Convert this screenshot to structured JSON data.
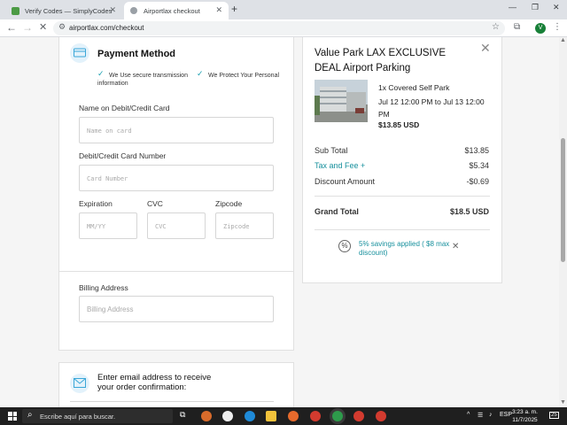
{
  "browser": {
    "tabs": [
      {
        "title": "Verify Codes — SimplyCodes",
        "active": false
      },
      {
        "title": "Airportlax checkout",
        "active": true
      }
    ],
    "url": "airportlax.com/checkout",
    "profile_initial": "V"
  },
  "payment": {
    "title": "Payment Method",
    "secure_note": "We Use secure transmission",
    "protect_note": "We Protect Your Personal information",
    "name_label": "Name on Debit/Credit Card",
    "name_placeholder": "Name on card",
    "number_label": "Debit/Credit Card Number",
    "number_placeholder": "Card Number",
    "expiration_label": "Expiration",
    "expiration_placeholder": "MM/YY",
    "cvc_label": "CVC",
    "cvc_placeholder": "CVC",
    "zip_label": "Zipcode",
    "zip_placeholder": "Zipcode"
  },
  "billing": {
    "label": "Billing Address",
    "placeholder": "Billing Address"
  },
  "email": {
    "title": "Enter email address to receive your order confirmation:"
  },
  "summary": {
    "title": "Value Park LAX EXCLUSIVE DEAL Airport Parking",
    "item": "1x Covered Self Park",
    "dates": "Jul 12 12:00 PM to Jul 13 12:00 PM",
    "item_price": "$13.85 USD",
    "subtotal_label": "Sub Total",
    "subtotal": "$13.85",
    "tax_label": "Tax and Fee +",
    "tax": "$5.34",
    "discount_label": "Discount Amount",
    "discount": "-$0.69",
    "grand_label": "Grand Total",
    "grand": "$18.5 USD",
    "savings": "5% savings applied ( $8 max discount)"
  },
  "taskbar": {
    "search_placeholder": "Escribe aquí para buscar.",
    "lang": "ESP",
    "time": "3:23 a. m.",
    "date": "11/7/2025",
    "notifications": "25"
  },
  "colors": {
    "accent": "#17909d",
    "check": "#1a9fb0",
    "icon_bg": "#e3f2fb"
  }
}
